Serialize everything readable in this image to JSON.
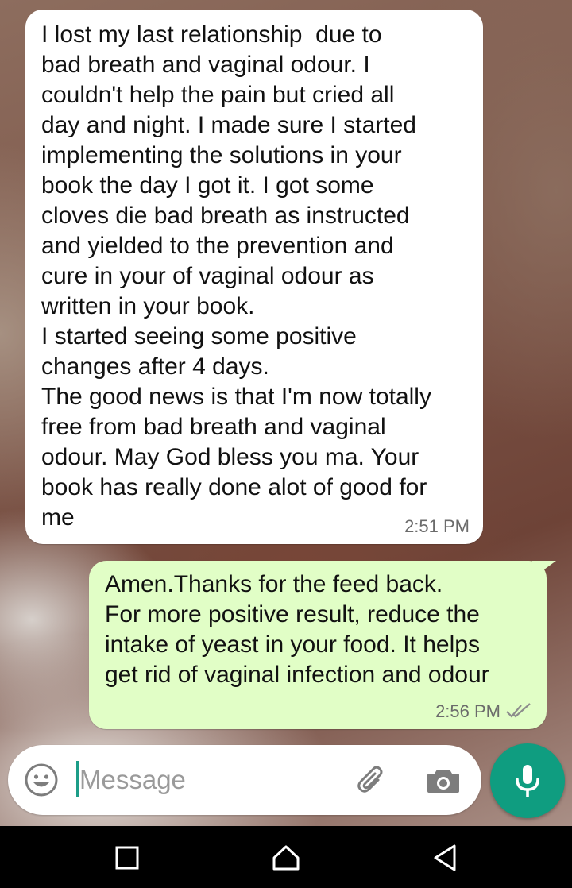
{
  "messages": [
    {
      "direction": "incoming",
      "text": "I lost my last relationship  due to\nbad breath and vaginal odour. I\ncouldn't help the pain but cried all\nday and night. I made sure I started\nimplementing the solutions in your\nbook the day I got it. I got some\ncloves die bad breath as instructed\nand yielded to the prevention and\ncure in your of vaginal odour as\nwritten in your book.\nI started seeing some positive\nchanges after 4 days.\nThe good news is that I'm now totally\nfree from bad breath and vaginal\nodour. May God bless you ma. Your\nbook has really done alot of good for\nme",
      "time": "2:51 PM"
    },
    {
      "direction": "outgoing",
      "text": "Amen.Thanks for the feed back.\nFor more positive result, reduce the\nintake of yeast in your food. It helps\nget rid of vaginal infection and odour",
      "time": "2:56 PM",
      "status_icon": "double-check-icon"
    }
  ],
  "composer": {
    "placeholder": "Message",
    "emoji_icon": "emoji-icon",
    "attach_icon": "paperclip-icon",
    "camera_icon": "camera-icon",
    "mic_icon": "microphone-icon"
  },
  "nav": {
    "recents_icon": "square-icon",
    "home_icon": "home-icon",
    "back_icon": "back-triangle-icon"
  },
  "colors": {
    "incoming_bubble": "#ffffff",
    "outgoing_bubble": "#e1fec6",
    "accent": "#0f9d80",
    "caret": "#1c9d88"
  }
}
